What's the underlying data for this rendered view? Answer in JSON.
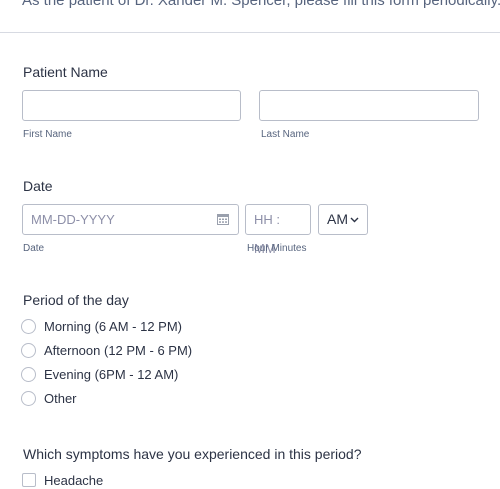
{
  "form": {
    "intro": "As the patient of Dr. Xander M. Spencer, please fill this form periodically.",
    "patient_name": {
      "label": "Patient Name",
      "first_sublabel": "First Name",
      "last_sublabel": "Last Name",
      "first_value": "",
      "last_value": ""
    },
    "date": {
      "label": "Date",
      "date_placeholder": "MM-DD-YYYY",
      "date_sublabel": "Date",
      "time_placeholder": "HH : MM",
      "time_sublabel": "Hour Minutes",
      "ampm_selected": "AM",
      "calendar_icon": "calendar-icon",
      "dropdown_icon": "chevron-down-icon"
    },
    "period": {
      "label": "Period of the day",
      "options": [
        "Morning (6 AM - 12 PM)",
        "Afternoon (12 PM - 6 PM)",
        "Evening (6PM - 12 AM)",
        "Other"
      ]
    },
    "symptoms": {
      "label": "Which symptoms have you experienced in this period?",
      "options": [
        "Headache"
      ]
    }
  }
}
